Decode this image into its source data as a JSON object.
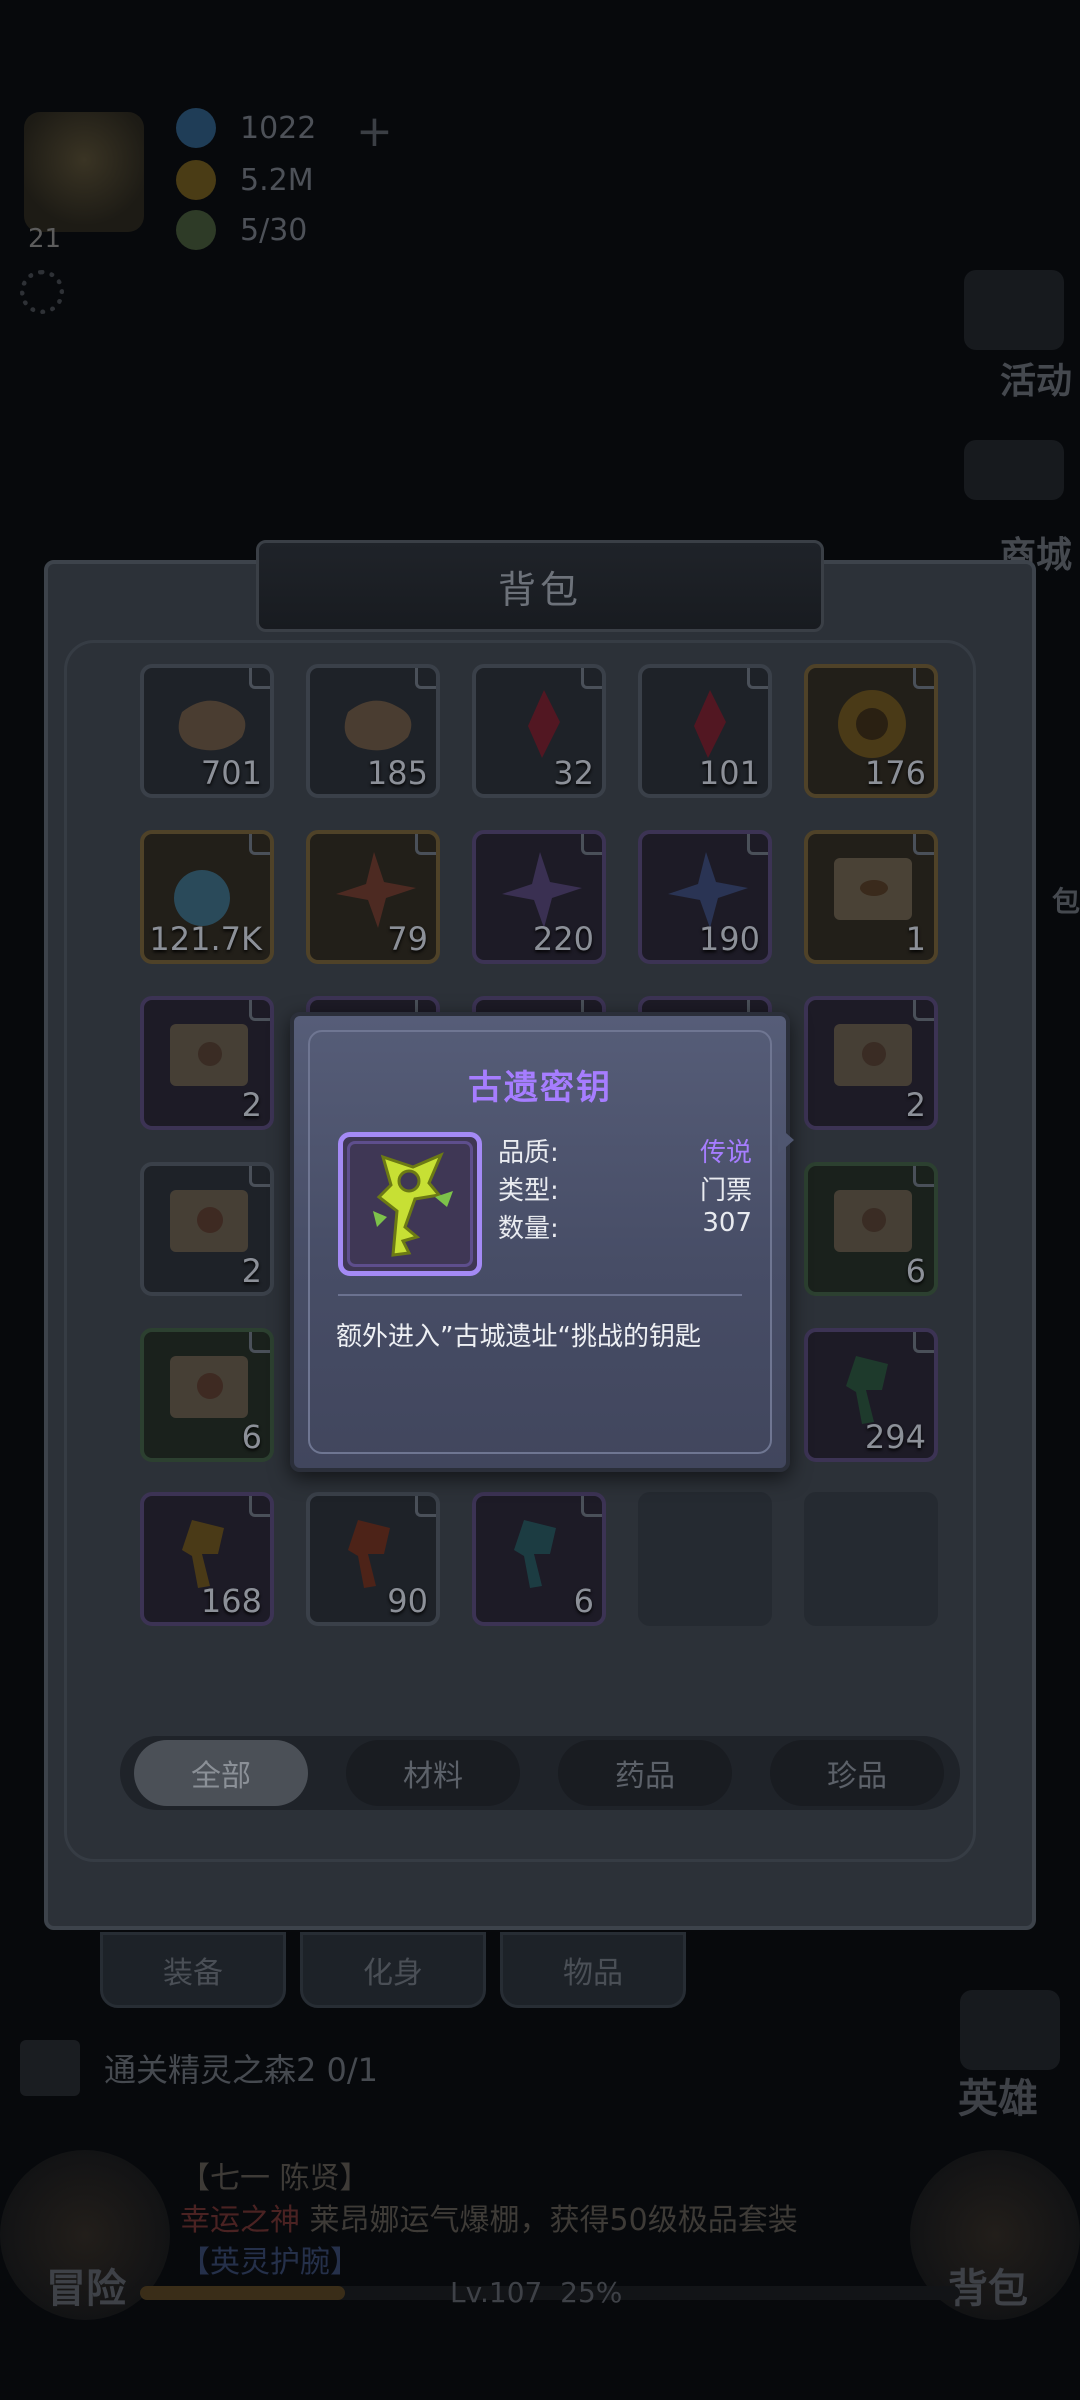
{
  "hud": {
    "level": "21",
    "resources": [
      {
        "icon": "diamond-icon",
        "value": "1022",
        "color": "#1f3d57"
      },
      {
        "icon": "gold-coin-icon",
        "value": "5.2M",
        "color": "#4a3c15"
      },
      {
        "icon": "stamina-icon",
        "value": "5/30",
        "color": "#2e3b27"
      }
    ],
    "add_label": "+",
    "side_labels": {
      "activity": "活动",
      "shop": "商城",
      "bag": "包"
    }
  },
  "bag": {
    "title": "背包",
    "slots": [
      {
        "item": "bone-fragment",
        "count": "701",
        "rarity": "normal"
      },
      {
        "item": "bone-fragment",
        "count": "185",
        "rarity": "normal"
      },
      {
        "item": "red-crystal",
        "count": "32",
        "rarity": "normal"
      },
      {
        "item": "red-crystal",
        "count": "101",
        "rarity": "normal"
      },
      {
        "item": "gold-emblem",
        "count": "176",
        "rarity": "gold"
      },
      {
        "item": "blue-orb",
        "count": "121.7K",
        "rarity": "gold"
      },
      {
        "item": "red-shuriken",
        "count": "79",
        "rarity": "gold"
      },
      {
        "item": "purple-shuriken",
        "count": "220",
        "rarity": "purple"
      },
      {
        "item": "blue-shuriken",
        "count": "190",
        "rarity": "purple"
      },
      {
        "item": "eye-scroll",
        "count": "1",
        "rarity": "gold"
      },
      {
        "item": "scroll",
        "count": "2",
        "rarity": "purple"
      },
      {
        "item": "scroll",
        "count": "",
        "rarity": "purple"
      },
      {
        "item": "scroll",
        "count": "",
        "rarity": "purple"
      },
      {
        "item": "scroll",
        "count": "",
        "rarity": "purple"
      },
      {
        "item": "scroll",
        "count": "2",
        "rarity": "purple"
      },
      {
        "item": "skull-scroll",
        "count": "2",
        "rarity": "normal"
      },
      {
        "item": "scroll",
        "count": "",
        "rarity": "normal"
      },
      {
        "item": "scroll",
        "count": "",
        "rarity": "normal"
      },
      {
        "item": "scroll",
        "count": "",
        "rarity": "normal"
      },
      {
        "item": "scroll",
        "count": "6",
        "rarity": "green"
      },
      {
        "item": "skull-scroll",
        "count": "6",
        "rarity": "green"
      },
      {
        "item": "scroll",
        "count": "",
        "rarity": "normal"
      },
      {
        "item": "scroll",
        "count": "",
        "rarity": "normal"
      },
      {
        "item": "scroll",
        "count": "",
        "rarity": "normal"
      },
      {
        "item": "green-key",
        "count": "294",
        "rarity": "purple"
      },
      {
        "item": "golden-key",
        "count": "168",
        "rarity": "purple"
      },
      {
        "item": "red-key",
        "count": "90",
        "rarity": "normal"
      },
      {
        "item": "teal-key",
        "count": "6",
        "rarity": "purple"
      },
      {
        "item": "",
        "count": "",
        "rarity": "empty"
      },
      {
        "item": "",
        "count": "",
        "rarity": "empty"
      }
    ],
    "tabs": [
      {
        "label": "全部",
        "active": true
      },
      {
        "label": "材料",
        "active": false
      },
      {
        "label": "药品",
        "active": false
      },
      {
        "label": "珍品",
        "active": false
      }
    ]
  },
  "popup": {
    "title": "古遗密钥",
    "quality_label": "品质:",
    "quality_value": "传说",
    "type_label": "类型:",
    "type_value": "门票",
    "count_label": "数量:",
    "count_value": "307",
    "description": "额外进入”古城遗址“挑战的钥匙",
    "accent": "#a67dff"
  },
  "bottom_tabs": [
    "装备",
    "化身",
    "物品"
  ],
  "quest": {
    "text": "通关精灵之森2 0/1"
  },
  "news": {
    "line1_prefix": "【",
    "line1_name": "七一 陈贤】",
    "line2_red": "幸运之神",
    "line2_text": "莱昂娜运气爆棚，获得50级极品套装",
    "line3": "【英灵护腕】"
  },
  "buttons": {
    "adventure": "冒险",
    "bag": "背包",
    "hero": "英雄"
  },
  "xp": {
    "level": "Lv.107",
    "percent": "25%",
    "fill": 0.25
  }
}
